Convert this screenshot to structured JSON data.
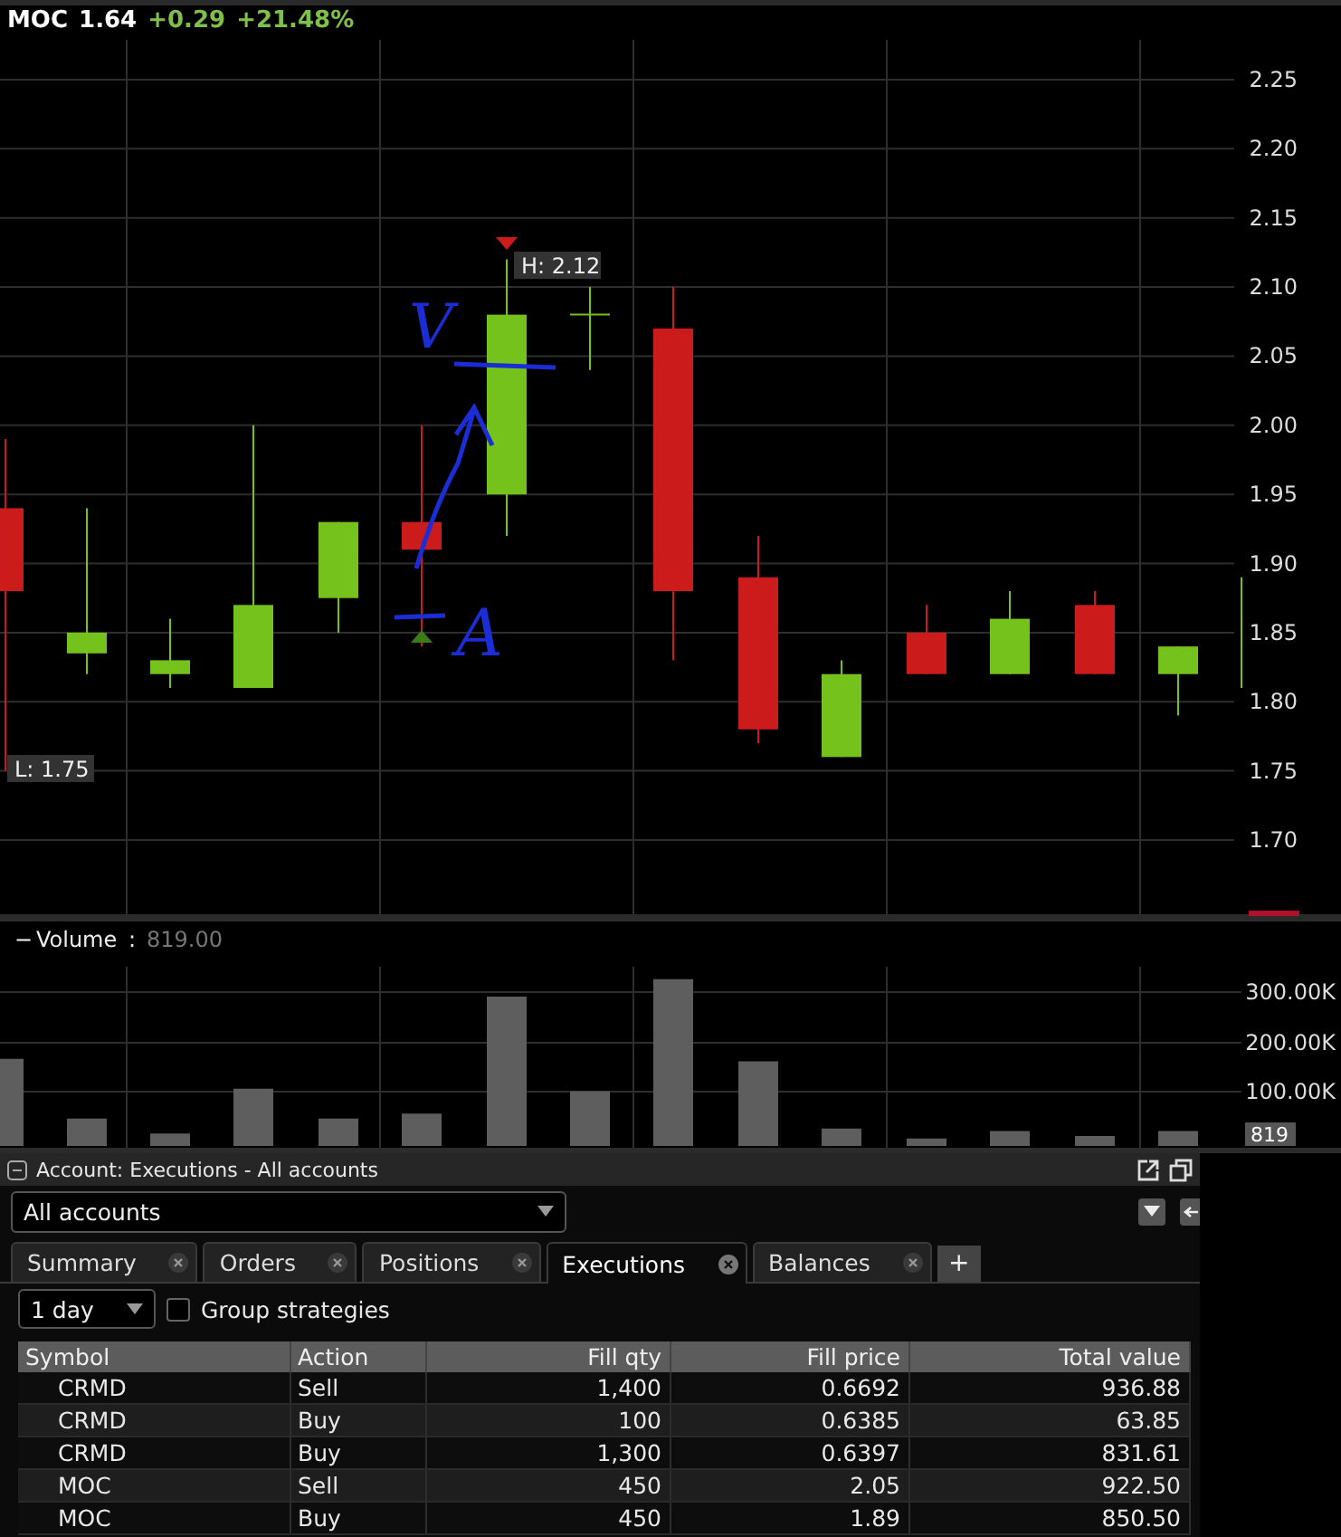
{
  "ticker": {
    "symbol": "MOC",
    "price": "1.64",
    "change": "+0.29",
    "change_pct": "+21.48%"
  },
  "price_axis": [
    "2.25",
    "2.20",
    "2.15",
    "2.10",
    "2.05",
    "2.00",
    "1.95",
    "1.90",
    "1.85",
    "1.80",
    "1.75",
    "1.70"
  ],
  "high_label": "H: 2.12",
  "low_label": "L: 1.75",
  "annotations": [
    "V",
    "A"
  ],
  "volume": {
    "collapse": "−",
    "label": "Volume",
    "separator": ":",
    "value": "819.00",
    "axis": [
      "300.00K",
      "200.00K",
      "100.00K"
    ],
    "last": "819"
  },
  "panel": {
    "title": "Account: Executions - All accounts",
    "account": "All accounts",
    "tabs": [
      {
        "label": "Summary",
        "selected": false
      },
      {
        "label": "Orders",
        "selected": false
      },
      {
        "label": "Positions",
        "selected": false
      },
      {
        "label": "Executions",
        "selected": true
      },
      {
        "label": "Balances",
        "selected": false
      }
    ],
    "add_tab": "+",
    "period": "1 day",
    "group_strategies": {
      "label": "Group strategies",
      "checked": false
    },
    "table": {
      "columns": [
        "Symbol",
        "Action",
        "Fill qty",
        "Fill price",
        "Total value"
      ],
      "rows": [
        [
          "CRMD",
          "Sell",
          "1,400",
          "0.6692",
          "936.88"
        ],
        [
          "CRMD",
          "Buy",
          "100",
          "0.6385",
          "63.85"
        ],
        [
          "CRMD",
          "Buy",
          "1,300",
          "0.6397",
          "831.61"
        ],
        [
          "MOC",
          "Sell",
          "450",
          "2.05",
          "922.50"
        ],
        [
          "MOC",
          "Buy",
          "450",
          "1.89",
          "850.50"
        ]
      ]
    }
  }
}
